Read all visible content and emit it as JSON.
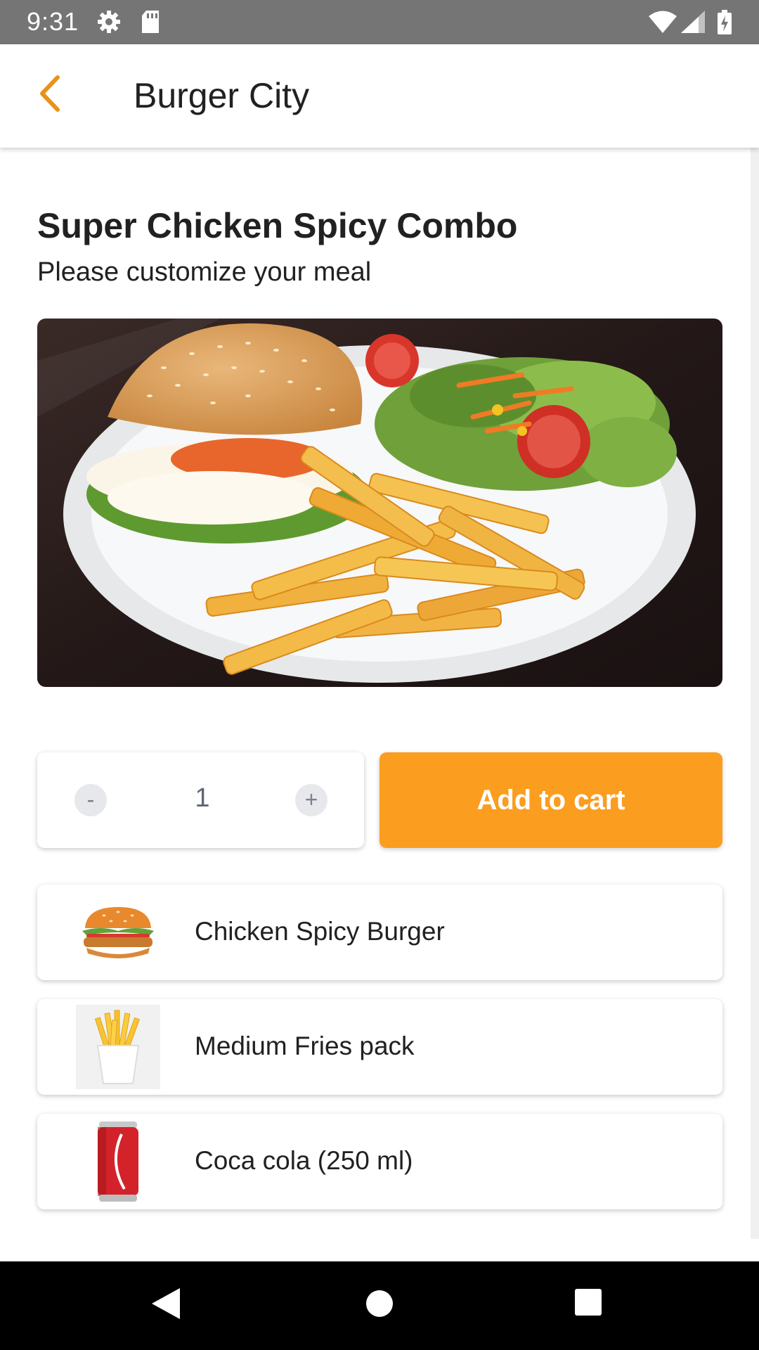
{
  "status_bar": {
    "time": "9:31",
    "icons": [
      "gear-icon",
      "sd-card-icon",
      "wifi-icon",
      "signal-icon",
      "battery-icon"
    ]
  },
  "app_bar": {
    "title": "Burger City",
    "back_icon": "chevron-left-icon",
    "accent_color": "#E8921E"
  },
  "product": {
    "title": "Super Chicken Spicy Combo",
    "subtitle": "Please customize your meal",
    "image": "burger-with-fries-and-salad-photo"
  },
  "quantity": {
    "minus_label": "-",
    "value": "1",
    "plus_label": "+"
  },
  "add_to_cart": {
    "label": "Add to cart",
    "color": "#FB9D1F"
  },
  "combo_items": [
    {
      "label": "Chicken Spicy Burger",
      "icon": "burger-icon"
    },
    {
      "label": "Medium Fries pack",
      "icon": "fries-icon"
    },
    {
      "label": "Coca cola (250 ml)",
      "icon": "cola-can-icon"
    }
  ],
  "nav_bar": {
    "icons": [
      "nav-back-icon",
      "nav-home-icon",
      "nav-recents-icon"
    ]
  }
}
